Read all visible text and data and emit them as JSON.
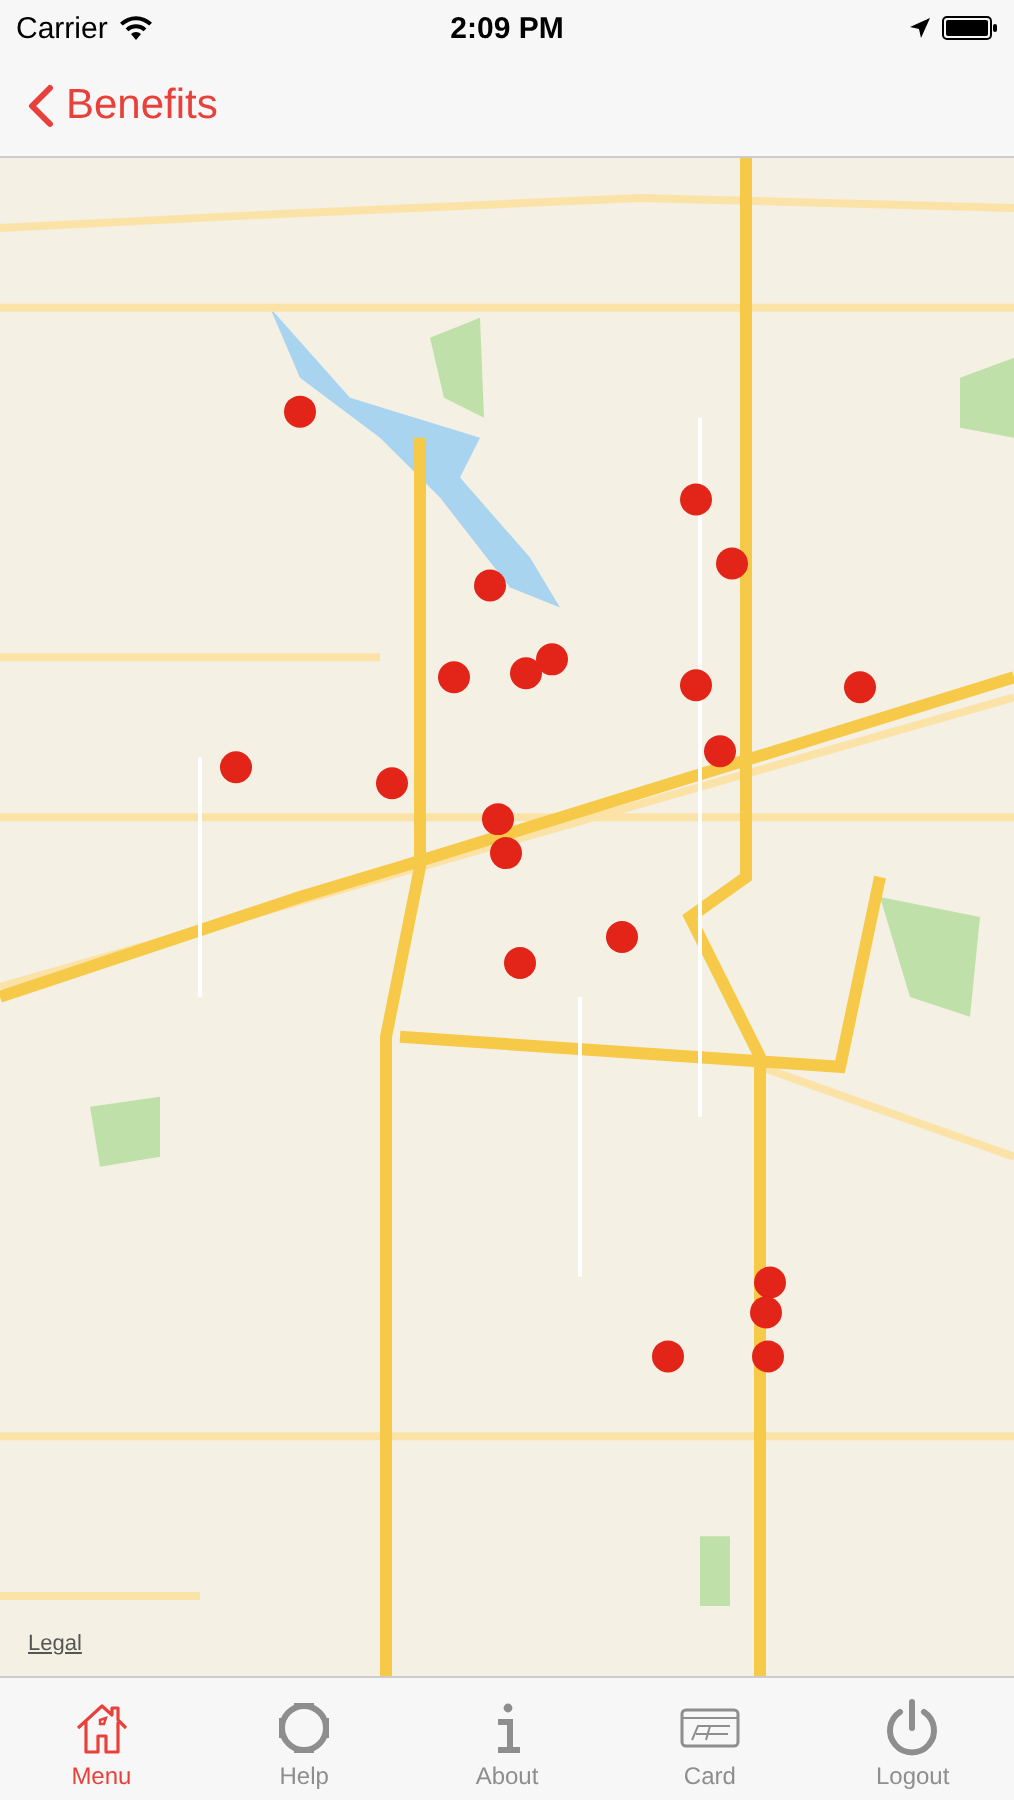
{
  "status_bar": {
    "carrier": "Carrier",
    "time": "2:09 PM"
  },
  "nav_bar": {
    "back_label": "Benefits"
  },
  "map": {
    "kind": "picture",
    "legal_link": "Legal"
  },
  "tab_bar": [
    {
      "kind": "home",
      "label": "Menu",
      "selected": true
    },
    {
      "kind": "help",
      "label": "Help",
      "selected": false
    },
    {
      "kind": "about",
      "label": "About",
      "selected": false
    },
    {
      "kind": "card",
      "label": "Card",
      "selected": false
    },
    {
      "kind": "logout",
      "label": "Logout",
      "selected": false
    }
  ]
}
